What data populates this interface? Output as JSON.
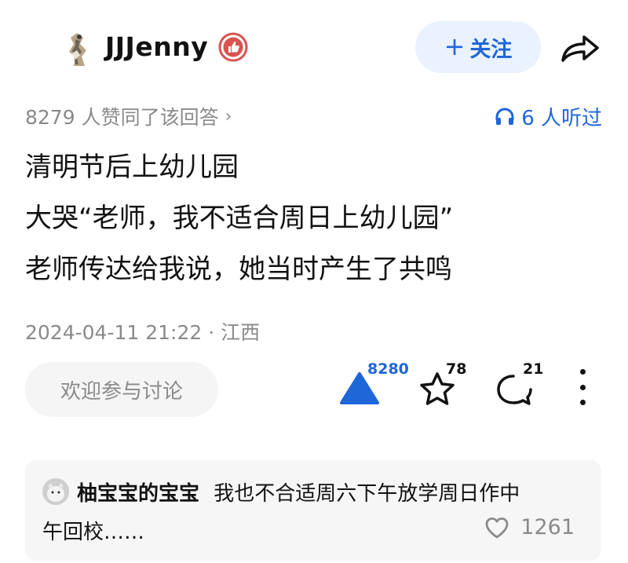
{
  "header": {
    "username": "JJJenny",
    "follow_label": "关注",
    "follow_plus": "+"
  },
  "stats": {
    "likes_text": "8279 人赞同了该回答",
    "chevron": "›",
    "listen_text": "6 人听过"
  },
  "content": {
    "lines": [
      "清明节后上幼儿园",
      "大哭“老师，我不适合周日上幼儿园”",
      "老师传达给我说，她当时产生了共鸣"
    ]
  },
  "meta": {
    "timestamp": "2024-04-11 21:22 · 江西"
  },
  "actions": {
    "discuss_label": "欢迎参与讨论",
    "upvote_count": "8280",
    "favorite_count": "78",
    "comment_count": "21"
  },
  "top_comment": {
    "author": "柚宝宝的宝宝",
    "text_line1": "我也不合适周六下午放学周日作中",
    "text_line2": "午回校……",
    "like_count": "1261"
  },
  "colors": {
    "accent": "#1f66d8",
    "follow_bg": "#e9f2fe",
    "muted_text": "#8a8a8a",
    "badge_red": "#d9534f"
  },
  "icons": {
    "badge": "thumbs-up-badge-icon",
    "share": "share-arrow-icon",
    "listen": "headphones-icon",
    "upvote": "upvote-triangle-icon",
    "favorite": "star-icon",
    "comment": "comment-bubble-icon",
    "more": "more-dots-icon",
    "like": "heart-icon"
  }
}
